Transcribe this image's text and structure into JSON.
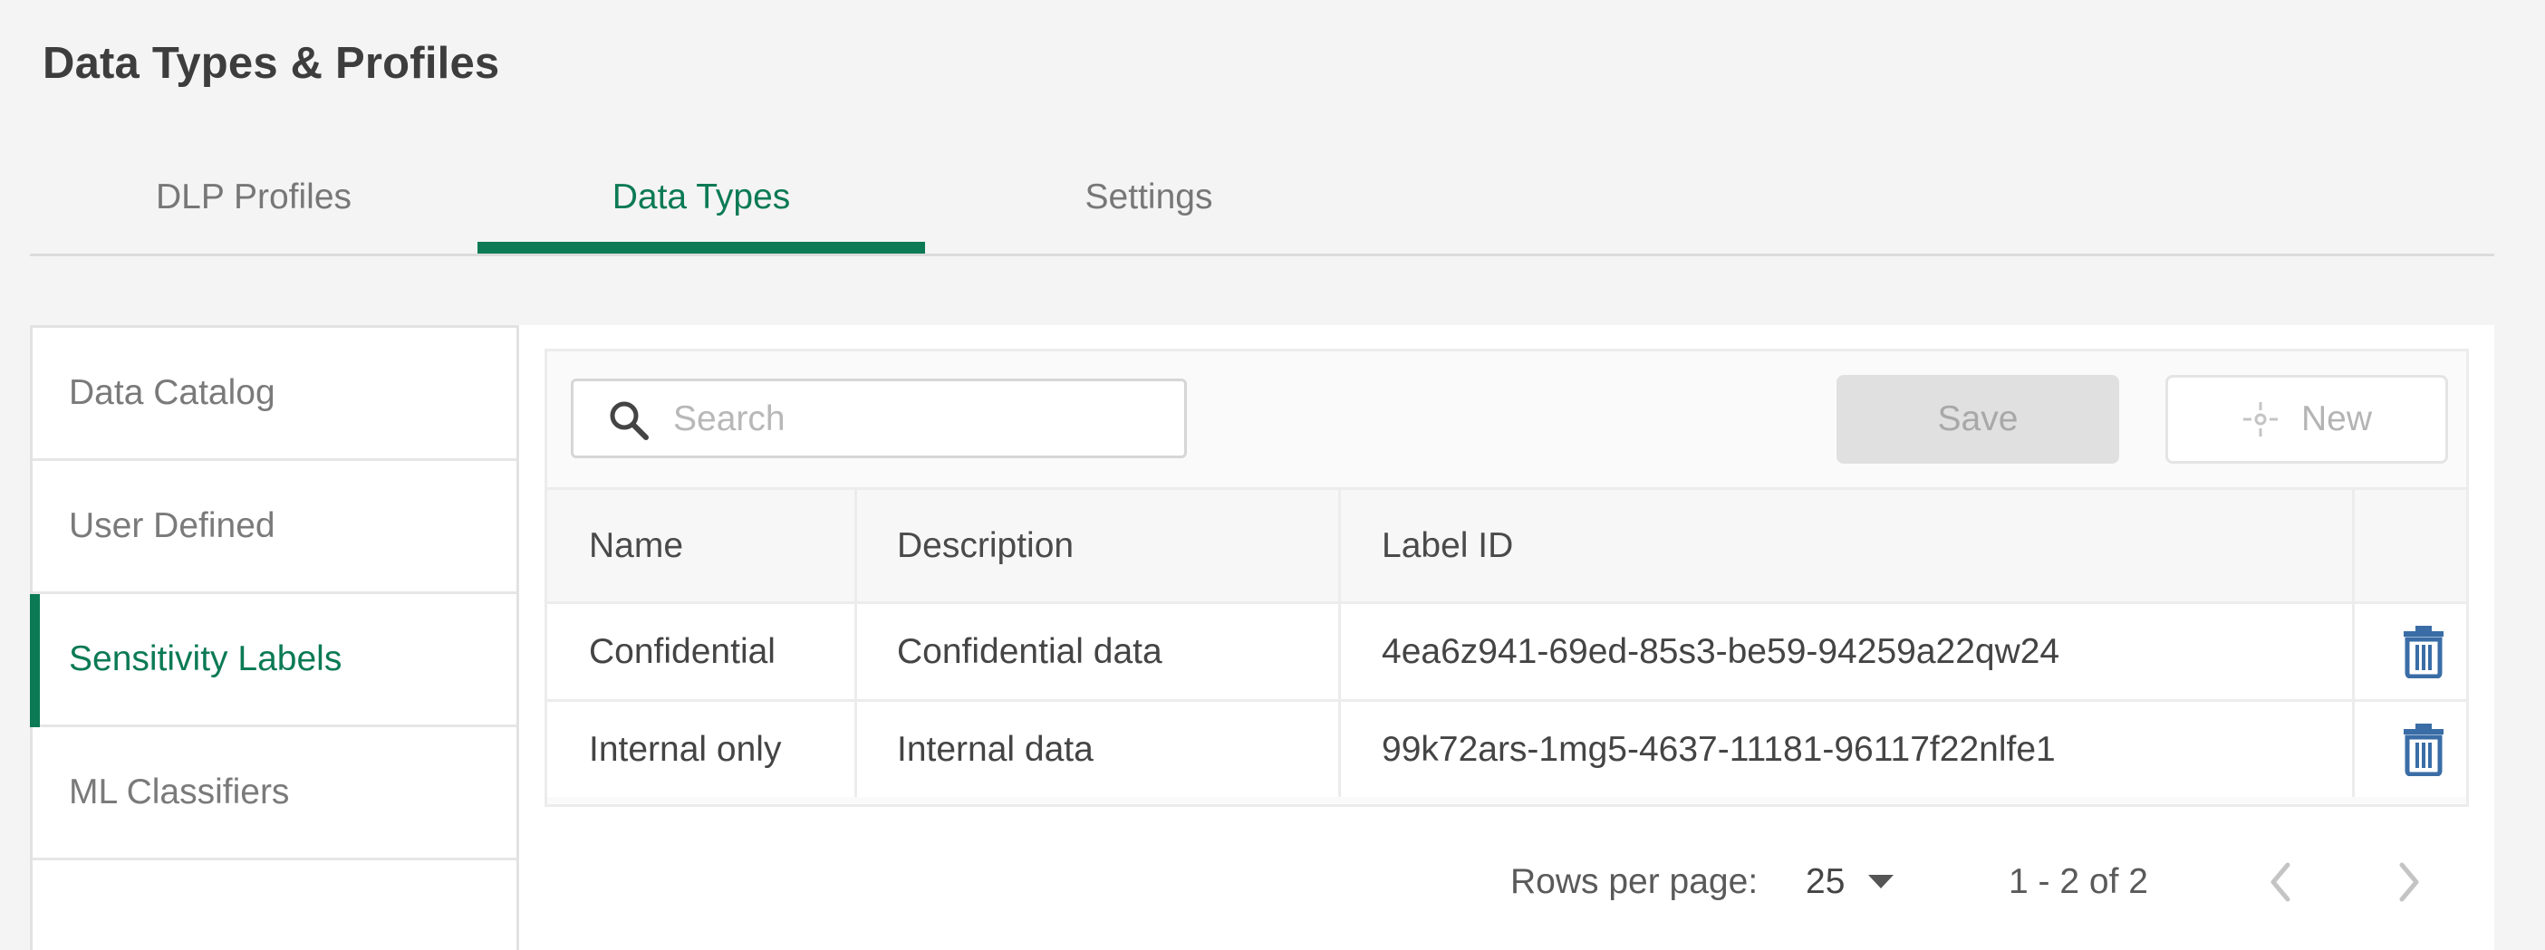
{
  "page": {
    "title": "Data Types & Profiles"
  },
  "tabs": [
    {
      "label": "DLP Profiles",
      "active": false
    },
    {
      "label": "Data Types",
      "active": true
    },
    {
      "label": "Settings",
      "active": false
    }
  ],
  "sidebar": {
    "items": [
      {
        "label": "Data Catalog",
        "active": false
      },
      {
        "label": "User Defined",
        "active": false
      },
      {
        "label": "Sensitivity Labels",
        "active": true
      },
      {
        "label": "ML Classifiers",
        "active": false
      }
    ]
  },
  "toolbar": {
    "search_placeholder": "Search",
    "search_value": "",
    "save_label": "Save",
    "new_label": "New",
    "save_disabled": true,
    "new_disabled": true
  },
  "table": {
    "columns": [
      "Name",
      "Description",
      "Label ID"
    ],
    "rows": [
      {
        "name": "Confidential",
        "description": "Confidential data",
        "label_id": "4ea6z941-69ed-85s3-be59-94259a22qw24"
      },
      {
        "name": "Internal only",
        "description": "Internal data",
        "label_id": "99k72ars-1mg5-4637-11181-96117f22nlfe1"
      }
    ]
  },
  "pagination": {
    "rows_per_page_label": "Rows per page:",
    "rows_per_page": "25",
    "range": "1 - 2 of 2"
  },
  "icons": {
    "search": "search-icon",
    "new": "crosshair-icon",
    "delete": "trash-icon",
    "dropdown": "caret-down-icon",
    "prev": "chevron-left-icon",
    "next": "chevron-right-icon"
  },
  "colors": {
    "accent": "#0b7a55",
    "delete_icon": "#3a6da6",
    "background": "#f4f4f4"
  }
}
